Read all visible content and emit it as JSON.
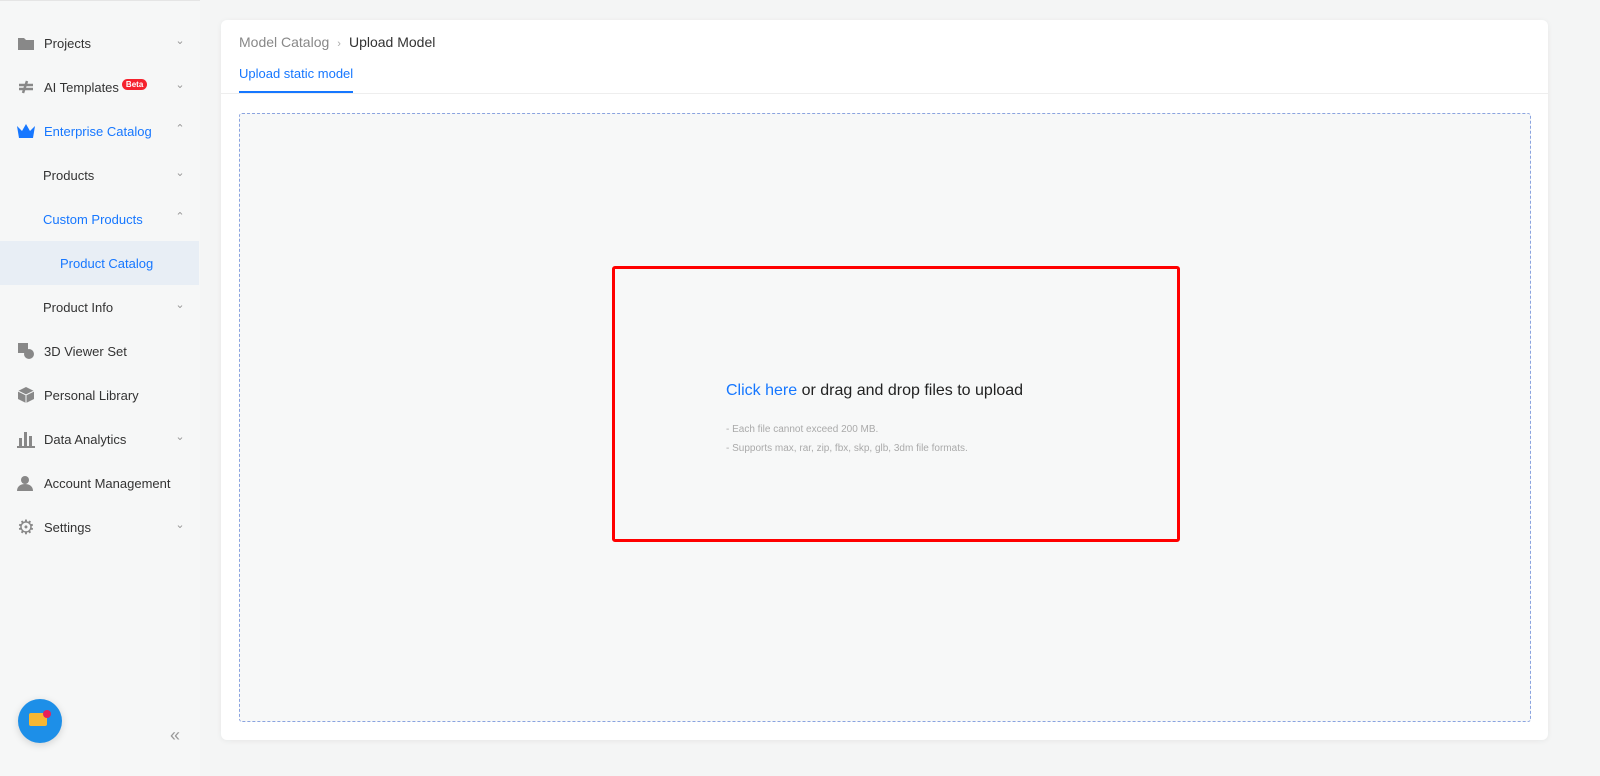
{
  "sidebar": {
    "items": [
      {
        "label": "Projects",
        "icon": "folder-icon"
      },
      {
        "label": "AI Templates",
        "badge": "Beta",
        "icon": "templates-icon"
      },
      {
        "label": "Enterprise Catalog",
        "icon": "crown-icon"
      },
      {
        "label": "Products"
      },
      {
        "label": "Custom Products"
      },
      {
        "label": "Product Catalog"
      },
      {
        "label": "Product Info"
      },
      {
        "label": "3D Viewer Set",
        "icon": "shapes-icon"
      },
      {
        "label": "Personal Library",
        "icon": "box-icon"
      },
      {
        "label": "Data Analytics",
        "icon": "bar-chart-icon"
      },
      {
        "label": "Account Management",
        "icon": "user-icon"
      },
      {
        "label": "Settings",
        "icon": "gear-icon"
      }
    ],
    "collapse": "«"
  },
  "breadcrumb": {
    "parent": "Model Catalog",
    "current": "Upload Model"
  },
  "tab": "Upload static model",
  "upload": {
    "link": "Click here",
    "text": " or drag and drop files to upload",
    "hints": [
      "- Each file cannot exceed 200 MB.",
      "- Supports max, rar, zip, fbx, skp, glb, 3dm file formats."
    ]
  },
  "colors": {
    "accent": "#1677ff",
    "highlight": "#ff0000"
  }
}
